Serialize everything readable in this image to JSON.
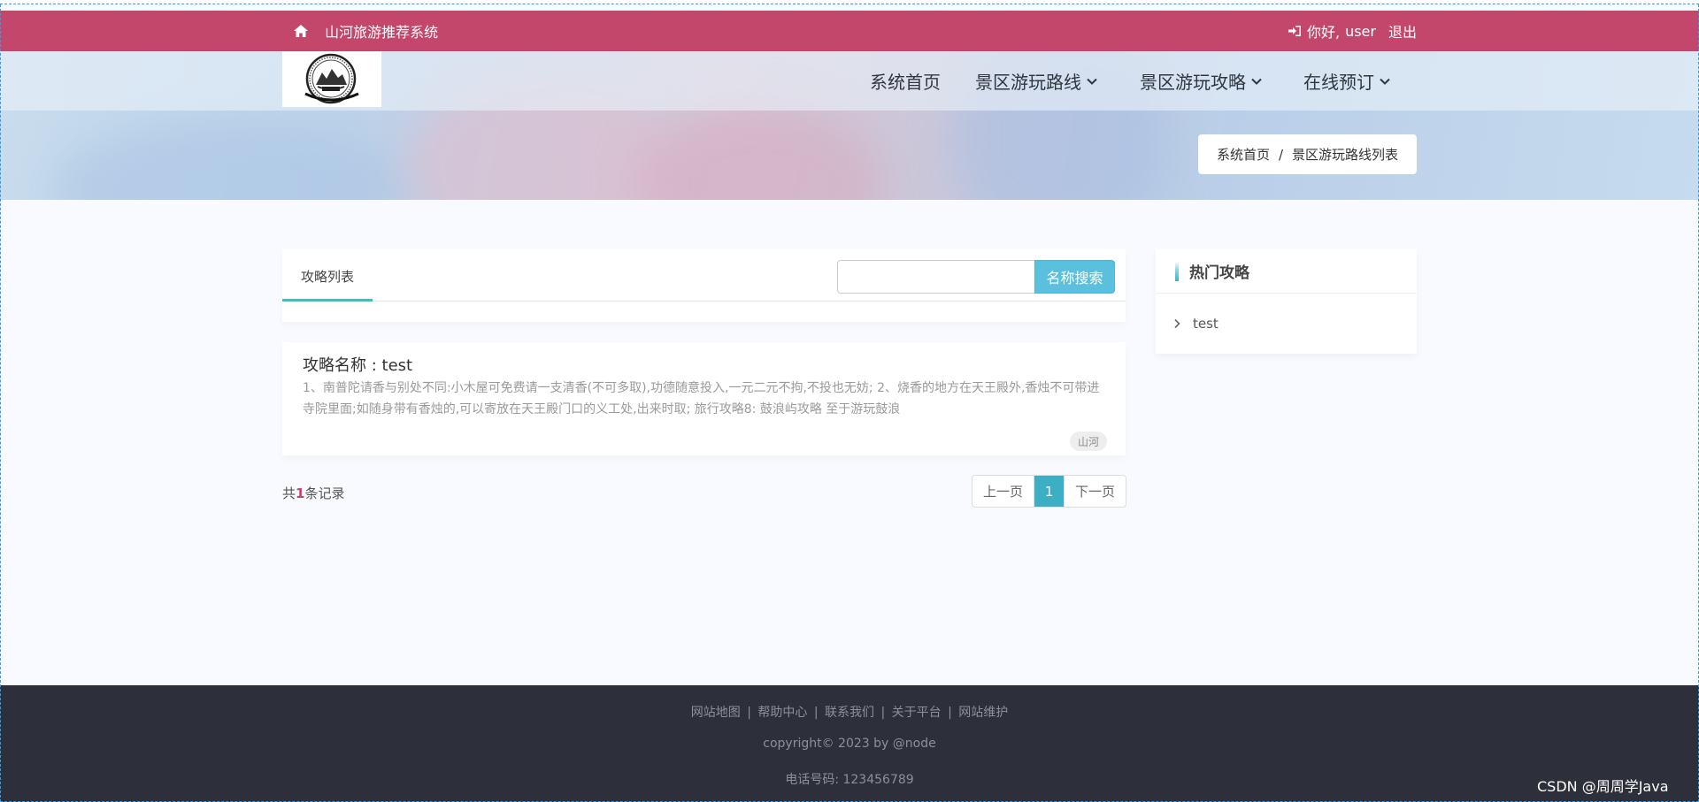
{
  "header": {
    "site_title": "山河旅游推荐系统",
    "greeting": "你好,",
    "username": "user",
    "logout_label": "退出"
  },
  "nav": {
    "items": [
      {
        "label": "系统首页",
        "has_dropdown": false
      },
      {
        "label": "景区游玩路线",
        "has_dropdown": true
      },
      {
        "label": "景区游玩攻略",
        "has_dropdown": true
      },
      {
        "label": "在线预订",
        "has_dropdown": true
      }
    ]
  },
  "breadcrumb": {
    "home": "系统首页",
    "separator": "/",
    "current": "景区游玩路线列表"
  },
  "list": {
    "tab_label": "攻略列表",
    "search_placeholder": "",
    "search_button": "名称搜索",
    "articles": [
      {
        "title": "攻略名称 : test",
        "summary": "1、南普陀请香与别处不同:小木屋可免费请一支清香(不可多取),功德随意投入,一元二元不拘,不投也无妨;        2、烧香的地方在天王殿外,香烛不可带进寺院里面;如随身带有香烛的,可以寄放在天王殿门口的义工处,出来时取;   旅行攻略8:  鼓浪屿攻略 至于游玩鼓浪",
        "tag": "山河"
      }
    ],
    "total_prefix": "共",
    "total_count": "1",
    "total_suffix": "条记录",
    "pager": {
      "prev": "上一页",
      "current": "1",
      "next": "下一页"
    }
  },
  "sidebar": {
    "title": "热门攻略",
    "items": [
      {
        "label": "test"
      }
    ]
  },
  "footer": {
    "links": [
      "网站地图",
      "帮助中心",
      "联系我们",
      "关于平台",
      "网站维护"
    ],
    "link_separator": "|",
    "copyright": "copyright© 2023 by @node",
    "phone": "电话号码: 123456789"
  },
  "watermark": "CSDN @周周学Java",
  "colors": {
    "topbar": "#c3476a",
    "accent": "#3cafc4",
    "search_button": "#5bc0de",
    "tab_underline": "#3cc0b7",
    "footer_bg": "#2d2f3a"
  }
}
